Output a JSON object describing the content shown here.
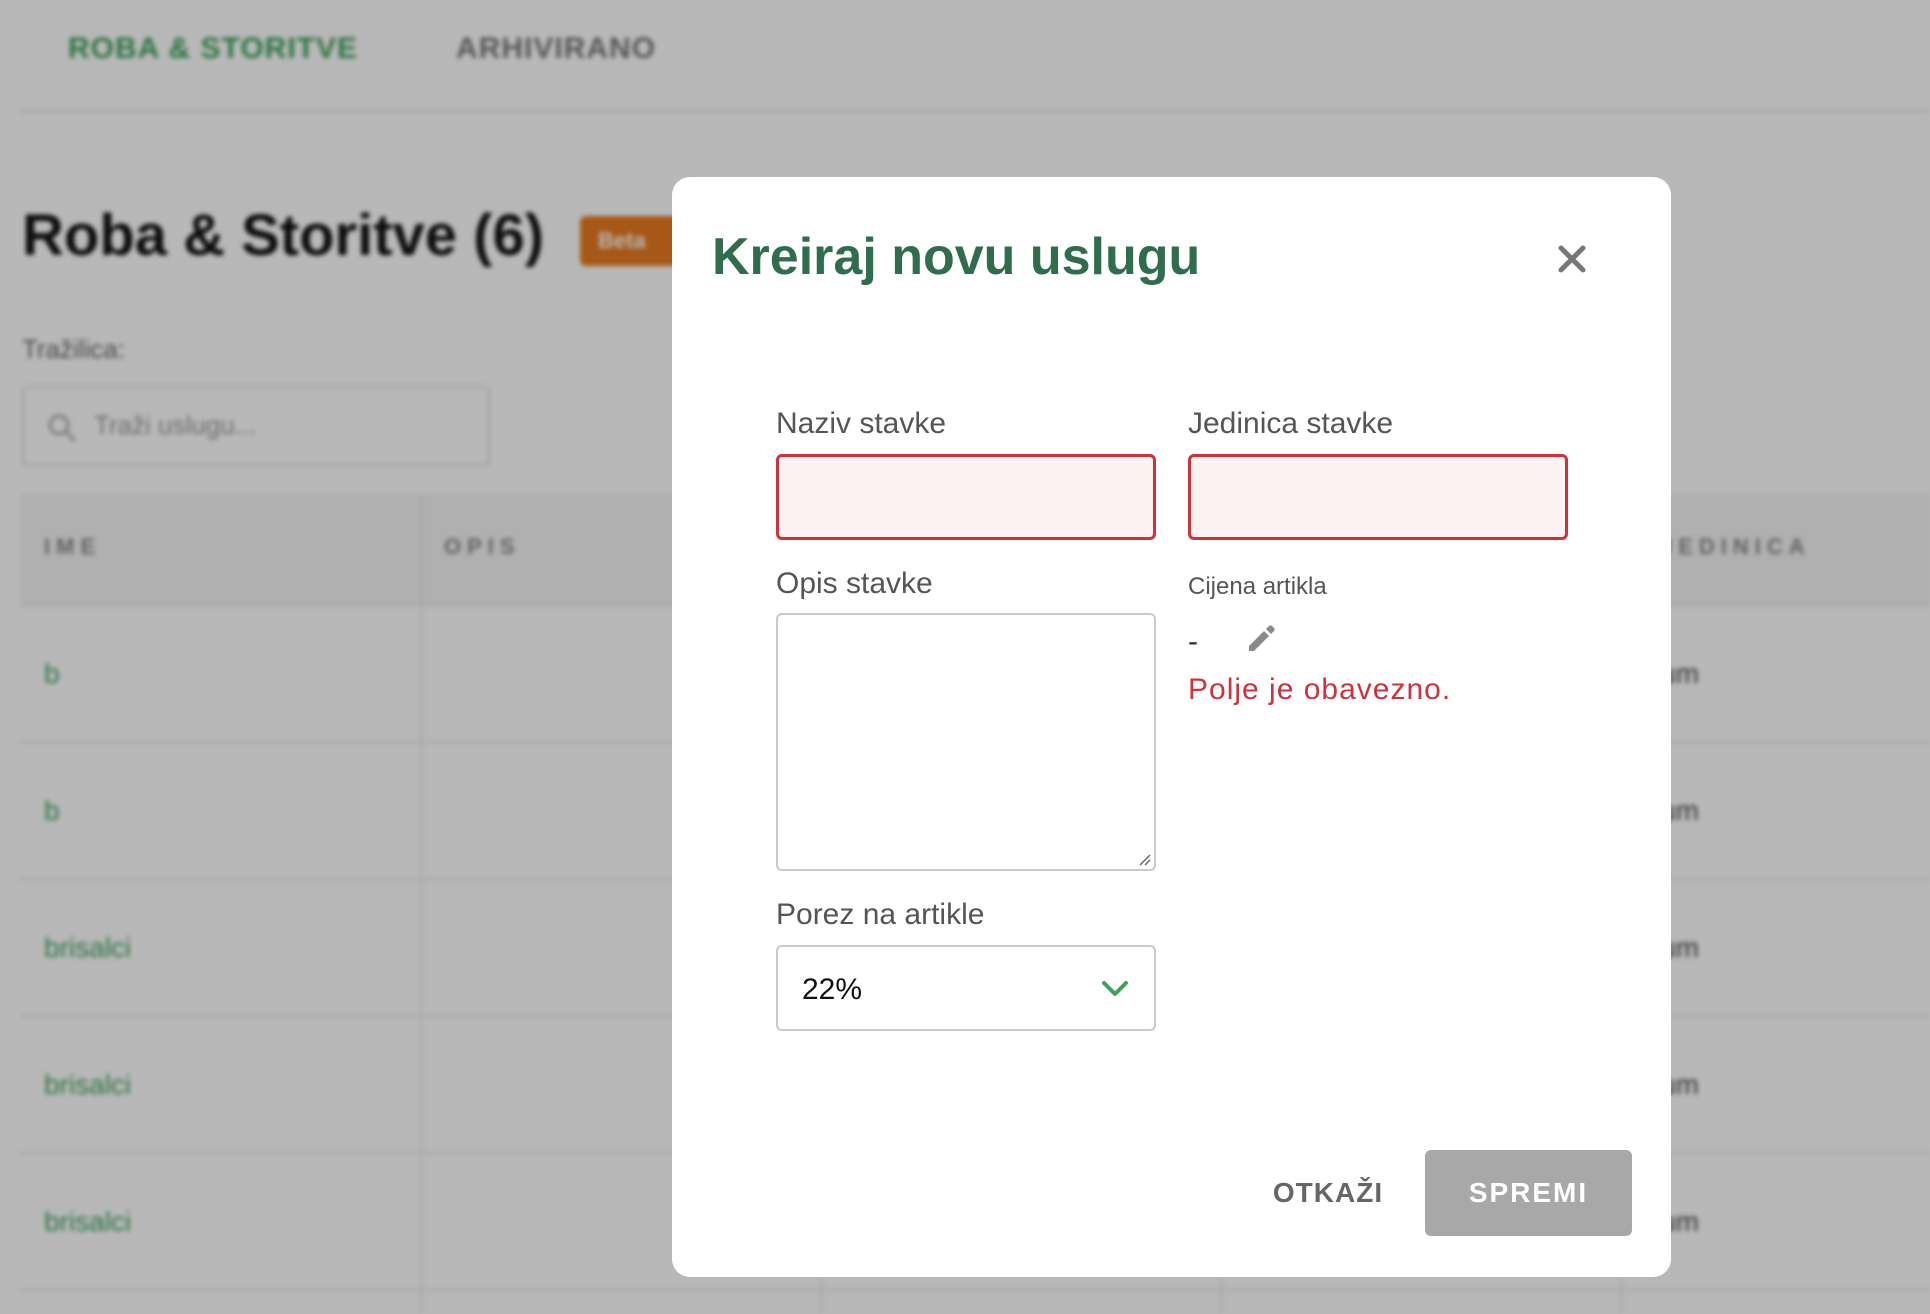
{
  "background": {
    "tabs": [
      {
        "label": "ROBA & STORITVE",
        "active": true
      },
      {
        "label": "ARHIVIRANO",
        "active": false
      }
    ],
    "page_title": "Roba & Storitve (6)",
    "beta_badge": "Beta",
    "search": {
      "label": "Tražilica:",
      "placeholder": "Traži uslugu..."
    },
    "table": {
      "columns": [
        "IME",
        "OPIS",
        "JEDINICA"
      ],
      "rows": [
        {
          "name": "b",
          "unit": "um"
        },
        {
          "name": "b",
          "unit": "um"
        },
        {
          "name": "brisalci",
          "unit": "um"
        },
        {
          "name": "brisalci",
          "unit": "um"
        },
        {
          "name": "brisalci",
          "unit": "um"
        }
      ]
    }
  },
  "modal": {
    "title": "Kreiraj novu uslugu",
    "fields": {
      "item_name_label": "Naziv stavke",
      "item_name_value": "",
      "item_unit_label": "Jedinica stavke",
      "item_unit_value": "",
      "description_label": "Opis stavke",
      "description_value": "",
      "price_label": "Cijena artikla",
      "price_value": "-",
      "required_error": "Polje je obavezno.",
      "tax_label": "Porez na artikle",
      "tax_value": "22%"
    },
    "buttons": {
      "cancel": "OTKAŽI",
      "save": "SPREMI"
    }
  },
  "colors": {
    "title": "#2f6d4c",
    "error": "#d0313a",
    "accent_green": "#3f9f5c",
    "save_disabled": "#a8a8a8"
  }
}
